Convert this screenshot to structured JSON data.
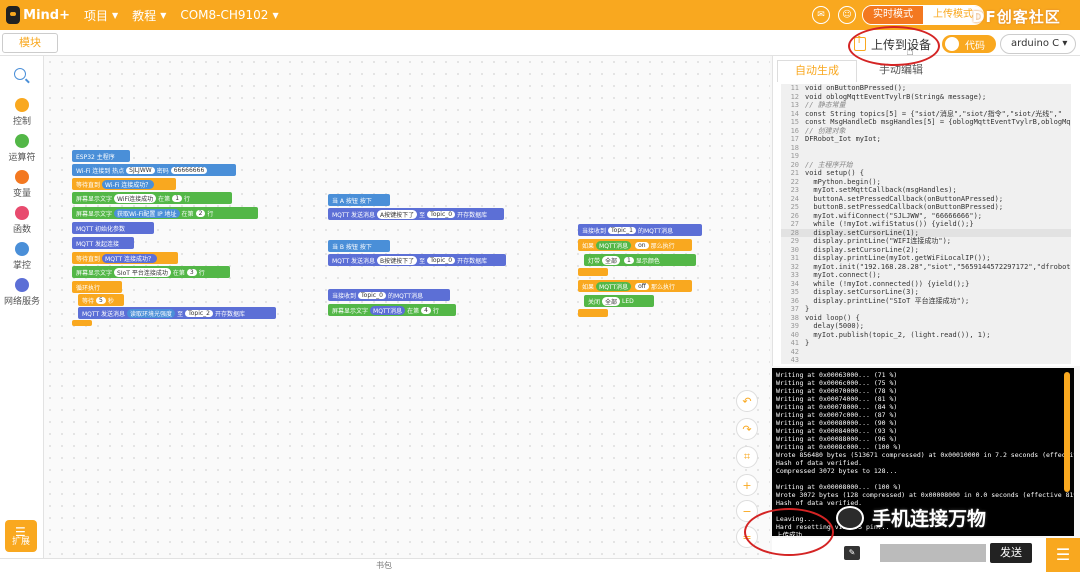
{
  "topbar": {
    "logo_text": "Mind+",
    "menus": [
      "项目",
      "教程",
      "COM8-CH9102"
    ],
    "mode_realtime": "实时模式",
    "mode_upload": "上传模式",
    "watermark": "DF创客社区",
    "brand_color": "#f9a81f"
  },
  "secondbar": {
    "tab_blocks": "模块",
    "upload_label": "上传到设备",
    "code_toggle_label": "代码",
    "device": "arduino C"
  },
  "categories": [
    "控制",
    "运算符",
    "变量",
    "函数",
    "掌控",
    "网络服务"
  ],
  "category_colors": [
    "#f9a81f",
    "#53b747",
    "#f37820",
    "#e84b6e",
    "#4a8fd8",
    "#5c6fd6"
  ],
  "extension_label": "扩展",
  "blocks": {
    "group1": [
      "ESP32 主程序",
      "Wi-Fi 连接到 热点",
      "SJLJWW",
      "密码",
      "66666666",
      "等待直到",
      "Wi-Fi 连接成功？",
      "屏幕显示文字",
      "WiFi连接成功",
      "在第",
      "1",
      "行",
      "屏幕显示文字",
      "获取Wi-Fi配置 IP 地址",
      "在第",
      "2",
      "行",
      "MQTT 初始化参数",
      "MQTT 发起连接",
      "等待直到",
      "MQTT 连接成功？",
      "屏幕显示文字",
      "SIoT 平台连接成功",
      "在第",
      "3",
      "行",
      "循环执行",
      "等待",
      "5",
      "秒",
      "MQTT 发送消息",
      "读取环境光强度",
      "至",
      "Topic_2",
      "开存数据库"
    ],
    "group2": [
      "当 A 按钮 按下",
      "MQTT 发送消息",
      "A按键按下了",
      "至",
      "Topic_0",
      "开存数据库"
    ],
    "group3": [
      "当 B 按钮 按下",
      "MQTT 发送消息",
      "B按键按下了",
      "至",
      "Topic_0",
      "开存数据库"
    ],
    "group4": [
      "当接收到",
      "Topic_0",
      "的",
      "MQTT消息",
      "屏幕显示文字",
      "MQTT消息",
      "在第",
      "4",
      "行"
    ],
    "group5": [
      "当接收到",
      "Topic_1",
      "的",
      "MQTT消息",
      "如果",
      "MQTT消息",
      "on",
      "那么执行",
      "灯带",
      "全部",
      "1",
      "显示颜色",
      "如果",
      "MQTT消息",
      "off",
      "那么执行",
      "关闭",
      "全部",
      "LED"
    ]
  },
  "code": {
    "tab_auto": "自动生成",
    "tab_manual": "手动编辑",
    "lines": [
      {
        "n": "11",
        "t": "void onButtonBPressed();"
      },
      {
        "n": "12",
        "t": "void oblogMqttEventTvylrB(String& message);"
      },
      {
        "n": "13",
        "t": "// 静态常量"
      },
      {
        "n": "14",
        "t": "const String topics[5] = {\"siot/消息\",\"siot/指令\",\"siot/光线\",\""
      },
      {
        "n": "15",
        "t": "const MsgHandleCb msgHandles[5] = {oblogMqttEventTvylrB,oblogMq"
      },
      {
        "n": "16",
        "t": "// 创建对象"
      },
      {
        "n": "17",
        "t": "DFRobot_Iot myIot;"
      },
      {
        "n": "18",
        "t": ""
      },
      {
        "n": "19",
        "t": ""
      },
      {
        "n": "20",
        "t": "// 主程序开始"
      },
      {
        "n": "21",
        "t": "void setup() {"
      },
      {
        "n": "22",
        "t": "  mPython.begin();"
      },
      {
        "n": "23",
        "t": "  myIot.setMqttCallback(msgHandles);"
      },
      {
        "n": "24",
        "t": "  buttonA.setPressedCallback(onButtonAPressed);"
      },
      {
        "n": "25",
        "t": "  buttonB.setPressedCallback(onButtonBPressed);"
      },
      {
        "n": "26",
        "t": "  myIot.wifiConnect(\"SJLJWW\", \"66666666\");"
      },
      {
        "n": "27",
        "t": "  while (!myIot.wifiStatus()) {yield();}"
      },
      {
        "n": "28",
        "t": "  display.setCursorLine(1);"
      },
      {
        "n": "29",
        "t": "  display.printLine(\"WIFI连接成功\");"
      },
      {
        "n": "30",
        "t": "  display.setCursorLine(2);"
      },
      {
        "n": "31",
        "t": "  display.printLine(myIot.getWiFiLocalIP());"
      },
      {
        "n": "32",
        "t": "  myIot.init(\"192.168.28.28\",\"siot\",\"5659144572297172\",\"dfrobot"
      },
      {
        "n": "33",
        "t": "  myIot.connect();"
      },
      {
        "n": "34",
        "t": "  while (!myIot.connected()) {yield();}"
      },
      {
        "n": "35",
        "t": "  display.setCursorLine(3);"
      },
      {
        "n": "36",
        "t": "  display.printLine(\"SIoT 平台连接成功\");"
      },
      {
        "n": "37",
        "t": "}"
      },
      {
        "n": "38",
        "t": "void loop() {"
      },
      {
        "n": "39",
        "t": "  delay(5000);"
      },
      {
        "n": "40",
        "t": "  myIot.publish(topic_2, (light.read()), 1);"
      },
      {
        "n": "41",
        "t": "}"
      },
      {
        "n": "42",
        "t": ""
      },
      {
        "n": "43",
        "t": ""
      }
    ]
  },
  "terminal": {
    "lines": [
      "Writing at 0x00063000... (71 %)",
      "Writing at 0x0006c000... (75 %)",
      "Writing at 0x00070000... (78 %)",
      "Writing at 0x00074000... (81 %)",
      "Writing at 0x00078000... (84 %)",
      "Writing at 0x0007c000... (87 %)",
      "Writing at 0x00080000... (90 %)",
      "Writing at 0x00084000... (93 %)",
      "Writing at 0x00088000... (96 %)",
      "Writing at 0x0008c000... (100 %)",
      "Wrote 856480 bytes (513671 compressed) at 0x00010000 in 7.2 seconds (effective",
      "Hash of data verified.",
      "Compressed 3072 bytes to 128...",
      "",
      "Writing at 0x00008000... (100 %)",
      "Wrote 3072 bytes (128 compressed) at 0x00008000 in 0.0 seconds (effective 8192.",
      "Hash of data verified.",
      "",
      "Leaving...",
      "Hard resetting via RTS pin...",
      "上传成功"
    ],
    "watermark": "手机连接万物"
  },
  "bottom": {
    "send_label": "发送",
    "status_label": "书包"
  }
}
